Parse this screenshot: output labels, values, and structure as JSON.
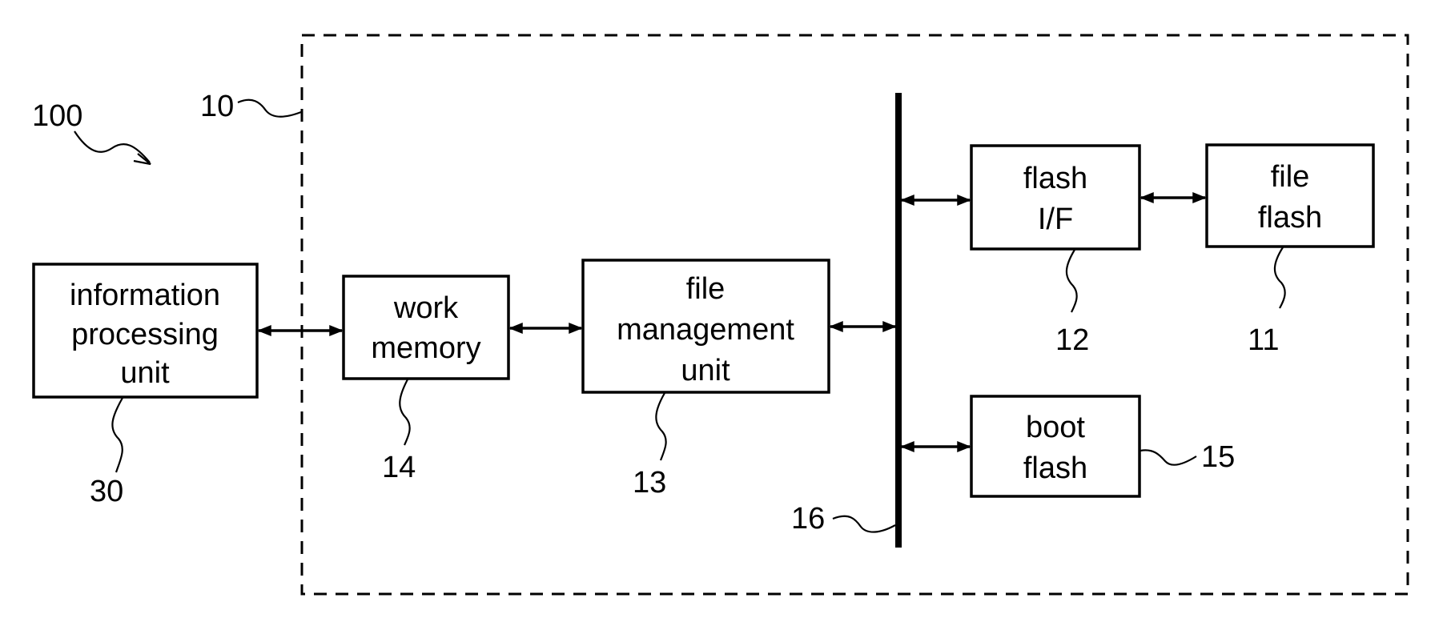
{
  "diagram": {
    "system_ref": "100",
    "device_ref": "10",
    "blocks": [
      {
        "id": "info",
        "ref": "30",
        "lines": [
          "information",
          "processing",
          "unit"
        ]
      },
      {
        "id": "work",
        "ref": "14",
        "lines": [
          "work",
          "memory"
        ]
      },
      {
        "id": "fmu",
        "ref": "13",
        "lines": [
          "file",
          "management",
          "unit"
        ]
      },
      {
        "id": "flashif",
        "ref": "12",
        "lines": [
          "flash",
          "I/F"
        ]
      },
      {
        "id": "fileflash",
        "ref": "11",
        "lines": [
          "file",
          "flash"
        ]
      },
      {
        "id": "bootflash",
        "ref": "15",
        "lines": [
          "boot",
          "flash"
        ]
      }
    ],
    "bus_ref": "16",
    "connections": [
      [
        "info",
        "work"
      ],
      [
        "work",
        "fmu"
      ],
      [
        "fmu",
        "bus"
      ],
      [
        "bus",
        "flashif"
      ],
      [
        "flashif",
        "fileflash"
      ],
      [
        "bus",
        "bootflash"
      ]
    ]
  }
}
